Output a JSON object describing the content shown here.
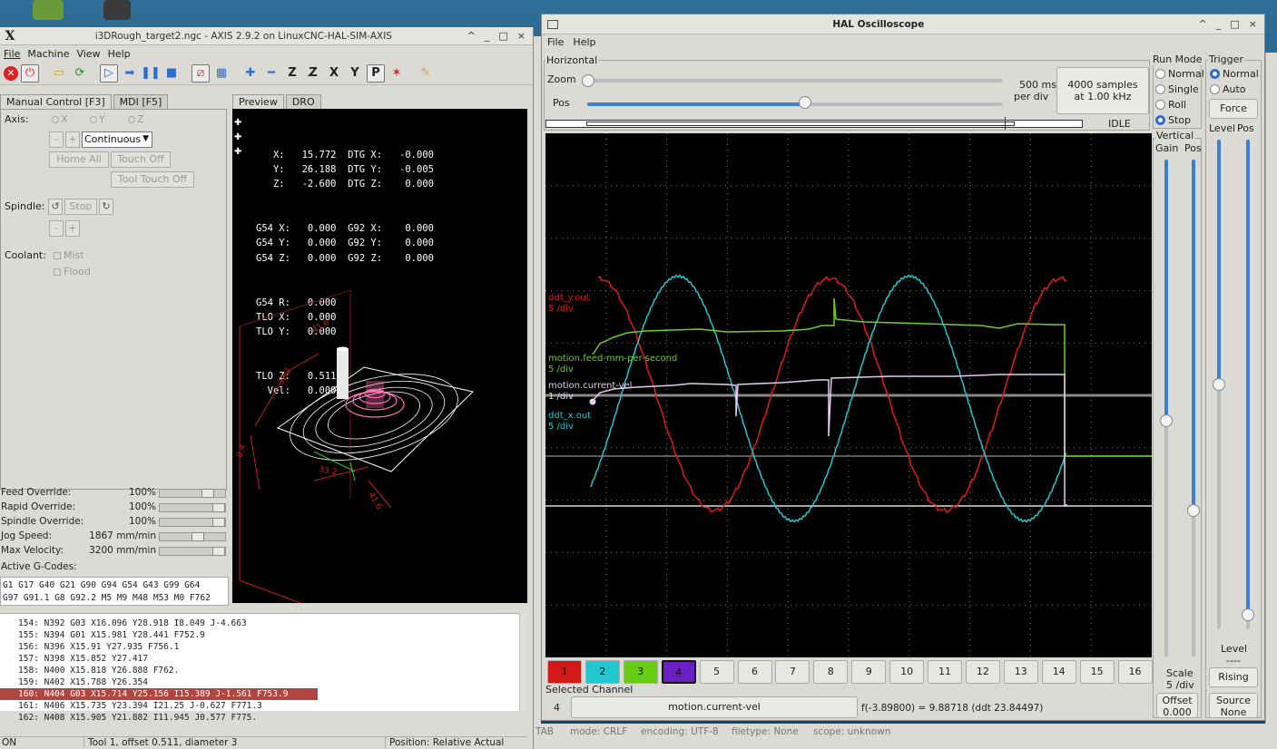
{
  "axis": {
    "app_glyph": "X",
    "title": "i3DRough_target2.ngc - AXIS 2.9.2 on LinuxCNC-HAL-SIM-AXIS",
    "window_controls": [
      "^",
      "_",
      "□",
      "×"
    ],
    "menu": [
      "File",
      "Machine",
      "View",
      "Help"
    ],
    "tabs": [
      "Manual Control [F3]",
      "MDI [F5]"
    ],
    "manual": {
      "axis_label": "Axis:",
      "axes": [
        "X",
        "Y",
        "Z"
      ],
      "minus": "-",
      "plus": "+",
      "jog_mode": "Continuous",
      "home_all": "Home All",
      "touch_off": "Touch Off",
      "tool_touch_off": "Tool Touch Off",
      "spindle_label": "Spindle:",
      "stop": "Stop",
      "coolant_label": "Coolant:",
      "mist": "Mist",
      "flood": "Flood"
    },
    "overrides": [
      {
        "name": "Feed Override:",
        "value": "100%",
        "level": 0.8
      },
      {
        "name": "Rapid Override:",
        "value": "100%",
        "level": 1.0
      },
      {
        "name": "Spindle Override:",
        "value": "100%",
        "level": 1.0
      },
      {
        "name": "Jog Speed:",
        "value": "1867 mm/min",
        "level": 0.6
      },
      {
        "name": "Max Velocity:",
        "value": "3200 mm/min",
        "level": 1.0
      }
    ],
    "active_gcodes_label": "Active G-Codes:",
    "active_gcodes": [
      "G1 G17 G40 G21 G90 G94 G54 G43 G99 G64",
      "G97 G91.1 G8 G92.2 M5 M9 M48 M53 M0 F762"
    ],
    "preview_tabs": [
      "Preview",
      "DRO"
    ],
    "dro": [
      "   X:   15.772  DTG X:   -0.000",
      "   Y:   26.188  DTG Y:   -0.005",
      "   Z:   -2.600  DTG Z:    0.000",
      "G54 X:   0.000  G92 X:    0.000",
      "G54 Y:   0.000  G92 Y:    0.000",
      "G54 Z:   0.000  G92 Z:    0.000",
      "G54 R:   0.000",
      "TLO X:   0.000",
      "TLO Y:   0.000",
      "TLO Z:   0.511",
      "  Vel:   0.000"
    ],
    "dimensions": [
      "41.6",
      "33.2",
      "8.4",
      "41.6",
      "33.2"
    ],
    "code_lines": [
      "154: N392 G03 X16.096 Y28.918 I8.049 J-4.663",
      "155: N394 G01 X15.981 Y28.441 F752.9",
      "156: N396 X15.91 Y27.935 F756.1",
      "157: N398 X15.852 Y27.417",
      "158: N400 X15.818 Y26.888 F762.",
      "159: N402 X15.788 Y26.354",
      "160: N404 G03 X15.714 Y25.156 I15.389 J-1.561 F753.9",
      "161: N406 X15.735 Y23.394 I21.25 J-0.627 F771.3",
      "162: N408 X15.905 Y21.882 I11.945 J0.577 F775."
    ],
    "highlighted_line": 6,
    "status": {
      "state": "ON",
      "tool": "Tool 1, offset 0.511, diameter 3",
      "position": "Position: Relative Actual"
    }
  },
  "scope": {
    "title": "HAL Oscilloscope",
    "window_controls": [
      "^",
      "_",
      "□",
      "×"
    ],
    "menu": [
      "File",
      "Help"
    ],
    "horizontal_label": "Horizontal",
    "zoom_label": "Zoom",
    "pos_label": "Pos",
    "timebase": "500 ms",
    "timebase_unit": "per div",
    "samples": "4000 samples",
    "rate": "at 1.00 kHz",
    "state": "IDLE",
    "run_mode_label": "Run Mode",
    "run_modes": [
      "Normal",
      "Single",
      "Roll",
      "Stop"
    ],
    "run_mode_selected": "Stop",
    "trigger_label": "Trigger",
    "trigger_modes": [
      "Normal",
      "Auto"
    ],
    "trigger_selected": "Normal",
    "force": "Force",
    "level_label": "Level",
    "pos_col_label": "Pos",
    "vertical_label": "Vertical",
    "gain_label": "Gain",
    "vpos_label": "Pos",
    "trigger_level_label": "Level",
    "trigger_level_value": "----",
    "rising": "Rising",
    "scale_label": "Scale",
    "scale_value": "5 /div",
    "offset_label": "Offset",
    "offset_value": "0.000",
    "source_label": "Source",
    "source_value": "None",
    "traces": [
      {
        "name": "ddt_y.out",
        "scale": "5 /div",
        "color": "#e01a1a"
      },
      {
        "name": "motion.feed-mm-per-second",
        "scale": "5 /div",
        "color": "#6fcf1f"
      },
      {
        "name": "motion.current-vel",
        "scale": "1 /div",
        "color": "#e6ccf2"
      },
      {
        "name": "ddt_x.out",
        "scale": "5 /div",
        "color": "#22c6cf"
      }
    ],
    "channels": [
      {
        "label": "1",
        "color": "#d31818"
      },
      {
        "label": "2",
        "color": "#21c6cf"
      },
      {
        "label": "3",
        "color": "#67cc14"
      },
      {
        "label": "4",
        "color": "#6a1fc4"
      },
      {
        "label": "5"
      },
      {
        "label": "6"
      },
      {
        "label": "7"
      },
      {
        "label": "8"
      },
      {
        "label": "9"
      },
      {
        "label": "10"
      },
      {
        "label": "11"
      },
      {
        "label": "12"
      },
      {
        "label": "13"
      },
      {
        "label": "14"
      },
      {
        "label": "15"
      },
      {
        "label": "16"
      }
    ],
    "selected_channel_label": "Selected Channel",
    "selected_channel_num": "4",
    "selected_channel_name": "motion.current-vel",
    "readout": "f(-3.89800) =  9.88718 (ddt  23.84497)"
  },
  "bottom_status": {
    "tab": "TAB",
    "mode": "mode: CRLF",
    "encoding": "encoding: UTF-8",
    "filetype": "filetype: None",
    "scope": "scope: unknown"
  }
}
